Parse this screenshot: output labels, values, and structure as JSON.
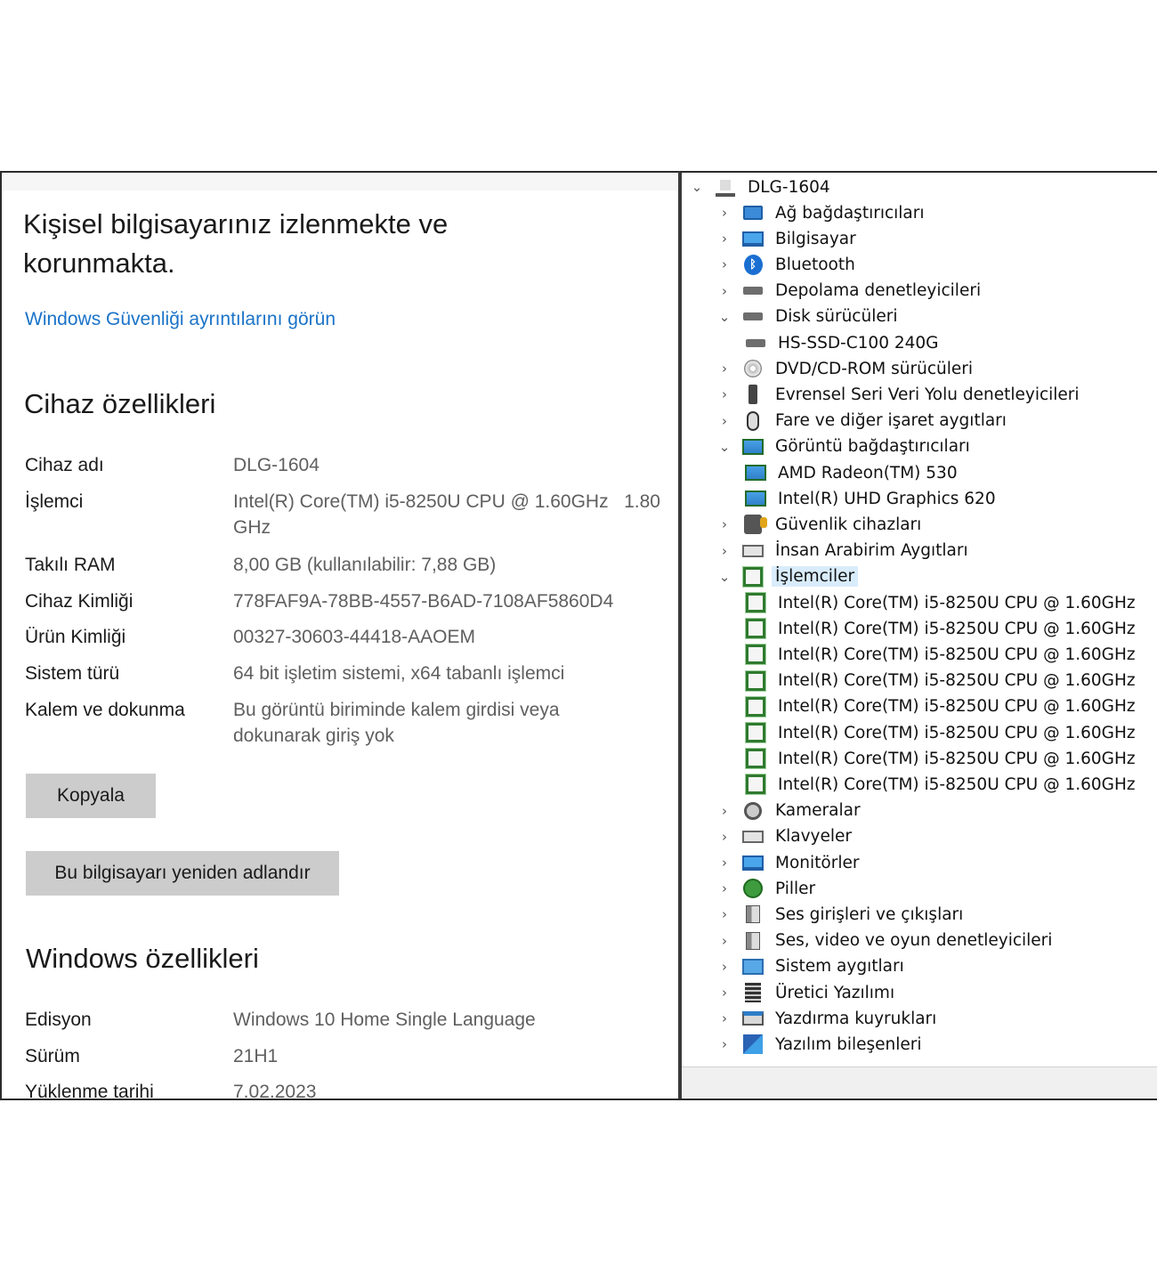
{
  "settings": {
    "hero_line1": "Kişisel bilgisayarınız izlenmekte ve",
    "hero_line2": "korunmakta.",
    "security_link": "Windows Güvenliği ayrıntılarını görün",
    "device_specs_title": "Cihaz özellikleri",
    "device_specs": [
      {
        "label": "Cihaz adı",
        "value": "DLG-1604"
      },
      {
        "label": "İşlemci",
        "value": "Intel(R) Core(TM) i5-8250U CPU @ 1.60GHz   1.80 GHz"
      },
      {
        "label": "Takılı RAM",
        "value": "8,00 GB (kullanılabilir: 7,88 GB)"
      },
      {
        "label": "Cihaz Kimliği",
        "value": "778FAF9A-78BB-4557-B6AD-7108AF5860D4"
      },
      {
        "label": "Ürün Kimliği",
        "value": "00327-30603-44418-AAOEM"
      },
      {
        "label": "Sistem türü",
        "value": "64 bit işletim sistemi, x64 tabanlı işlemci"
      },
      {
        "label": "Kalem ve dokunma",
        "value": "Bu görüntü biriminde kalem girdisi veya dokunarak giriş yok"
      }
    ],
    "copy_button": "Kopyala",
    "rename_button": "Bu bilgisayarı yeniden adlandır",
    "windows_specs_title": "Windows özellikleri",
    "windows_specs": [
      {
        "label": "Edisyon",
        "value": "Windows 10 Home Single Language"
      },
      {
        "label": "Sürüm",
        "value": "21H1"
      },
      {
        "label": "Yüklenme tarihi",
        "value": "7.02.2023"
      }
    ]
  },
  "device_manager": {
    "root": "DLG-1604",
    "items": [
      {
        "label": "Ağ bağdaştırıcıları",
        "icon": "network-adapter-icon",
        "level": 1,
        "expanded": false
      },
      {
        "label": "Bilgisayar",
        "icon": "computer-icon",
        "level": 1,
        "expanded": false
      },
      {
        "label": "Bluetooth",
        "icon": "bluetooth-icon",
        "level": 1,
        "expanded": false
      },
      {
        "label": "Depolama denetleyicileri",
        "icon": "storage-controller-icon",
        "level": 1,
        "expanded": false
      },
      {
        "label": "Disk sürücüleri",
        "icon": "disk-drive-icon",
        "level": 1,
        "expanded": true
      },
      {
        "label": "HS-SSD-C100 240G",
        "icon": "disk-drive-icon",
        "level": 2
      },
      {
        "label": "DVD/CD-ROM sürücüleri",
        "icon": "dvd-icon",
        "level": 1,
        "expanded": false
      },
      {
        "label": "Evrensel Seri Veri Yolu denetleyicileri",
        "icon": "usb-icon",
        "level": 1,
        "expanded": false
      },
      {
        "label": "Fare ve diğer işaret aygıtları",
        "icon": "mouse-icon",
        "level": 1,
        "expanded": false
      },
      {
        "label": "Görüntü bağdaştırıcıları",
        "icon": "display-adapter-icon",
        "level": 1,
        "expanded": true
      },
      {
        "label": "AMD Radeon(TM) 530",
        "icon": "display-adapter-icon",
        "level": 2
      },
      {
        "label": "Intel(R) UHD Graphics 620",
        "icon": "display-adapter-icon",
        "level": 2
      },
      {
        "label": "Güvenlik cihazları",
        "icon": "security-device-icon",
        "level": 1,
        "expanded": false
      },
      {
        "label": "İnsan Arabirim Aygıtları",
        "icon": "hid-icon",
        "level": 1,
        "expanded": false
      },
      {
        "label": "İşlemciler",
        "icon": "processor-icon",
        "level": 1,
        "expanded": true,
        "selected": true
      },
      {
        "label": "Intel(R) Core(TM) i5-8250U CPU @ 1.60GHz",
        "icon": "processor-icon",
        "level": 2
      },
      {
        "label": "Intel(R) Core(TM) i5-8250U CPU @ 1.60GHz",
        "icon": "processor-icon",
        "level": 2
      },
      {
        "label": "Intel(R) Core(TM) i5-8250U CPU @ 1.60GHz",
        "icon": "processor-icon",
        "level": 2
      },
      {
        "label": "Intel(R) Core(TM) i5-8250U CPU @ 1.60GHz",
        "icon": "processor-icon",
        "level": 2
      },
      {
        "label": "Intel(R) Core(TM) i5-8250U CPU @ 1.60GHz",
        "icon": "processor-icon",
        "level": 2
      },
      {
        "label": "Intel(R) Core(TM) i5-8250U CPU @ 1.60GHz",
        "icon": "processor-icon",
        "level": 2
      },
      {
        "label": "Intel(R) Core(TM) i5-8250U CPU @ 1.60GHz",
        "icon": "processor-icon",
        "level": 2
      },
      {
        "label": "Intel(R) Core(TM) i5-8250U CPU @ 1.60GHz",
        "icon": "processor-icon",
        "level": 2
      },
      {
        "label": "Kameralar",
        "icon": "camera-icon",
        "level": 1,
        "expanded": false
      },
      {
        "label": "Klavyeler",
        "icon": "keyboard-icon",
        "level": 1,
        "expanded": false
      },
      {
        "label": "Monitörler",
        "icon": "monitor-icon",
        "level": 1,
        "expanded": false
      },
      {
        "label": "Piller",
        "icon": "battery-icon",
        "level": 1,
        "expanded": false
      },
      {
        "label": "Ses girişleri ve çıkışları",
        "icon": "speaker-icon",
        "level": 1,
        "expanded": false
      },
      {
        "label": "Ses, video ve oyun denetleyicileri",
        "icon": "speaker-icon",
        "level": 1,
        "expanded": false
      },
      {
        "label": "Sistem aygıtları",
        "icon": "system-device-icon",
        "level": 1,
        "expanded": false
      },
      {
        "label": "Üretici Yazılımı",
        "icon": "firmware-icon",
        "level": 1,
        "expanded": false
      },
      {
        "label": "Yazdırma kuyrukları",
        "icon": "printer-icon",
        "level": 1,
        "expanded": false
      },
      {
        "label": "Yazılım bileşenleri",
        "icon": "software-component-icon",
        "level": 1,
        "expanded": false
      }
    ]
  }
}
